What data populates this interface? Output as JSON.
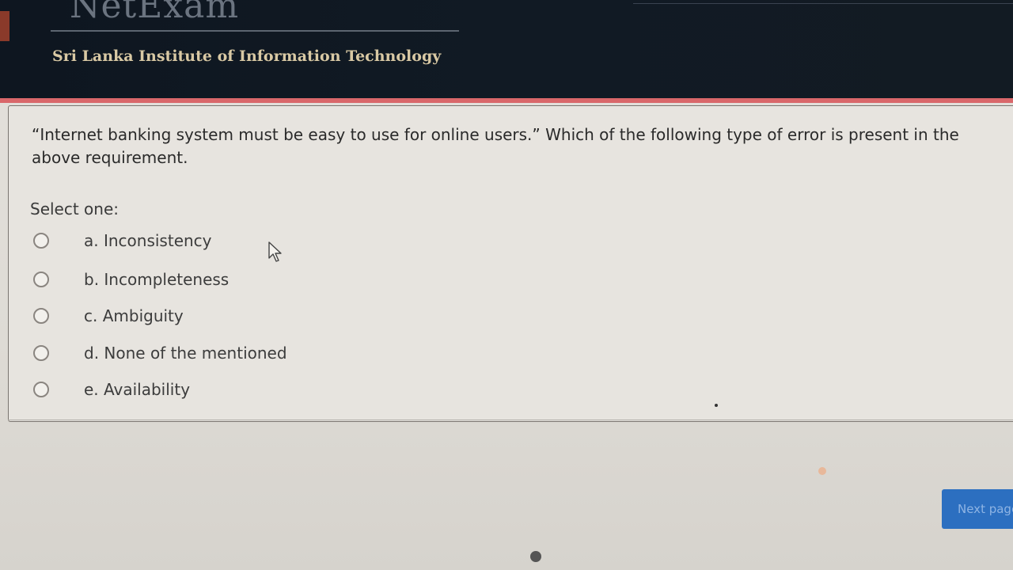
{
  "header": {
    "logo_text": "NetExam",
    "institute": "Sri Lanka Institute of Information Technology"
  },
  "question": {
    "text": "“Internet banking system must be easy to use for online users.” Which of the following type of error is present in the above requirement.",
    "select_label": "Select one:",
    "options": [
      {
        "label": "a. Inconsistency"
      },
      {
        "label": "b. Incompleteness"
      },
      {
        "label": "c. Ambiguity"
      },
      {
        "label": "d. None of the mentioned"
      },
      {
        "label": "e. Availability"
      }
    ]
  },
  "navigation": {
    "next_label": "Next page"
  },
  "colors": {
    "header_bg": "#0e1620",
    "header_accent": "#d9676a",
    "institute_text": "#d9c9a4",
    "button": "#2c6fc0"
  }
}
